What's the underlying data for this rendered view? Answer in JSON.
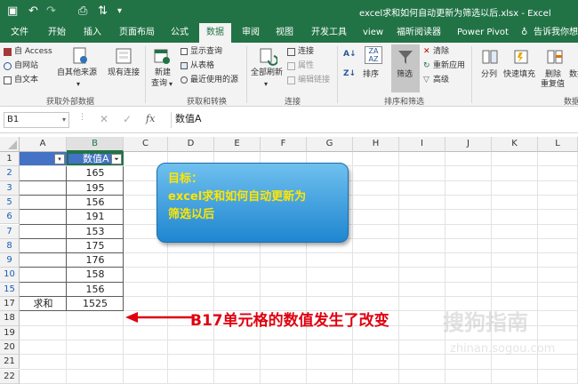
{
  "titlebar": {
    "title": "excel求和如何自动更新为筛选以后.xlsx  -  Excel",
    "icons": [
      "save-icon",
      "undo-icon",
      "redo-icon",
      "print-preview-icon",
      "sort-icon",
      "customize-icon"
    ]
  },
  "tabs": [
    {
      "label": "文件"
    },
    {
      "label": "开始"
    },
    {
      "label": "插入"
    },
    {
      "label": "页面布局"
    },
    {
      "label": "公式"
    },
    {
      "label": "数据",
      "active": true
    },
    {
      "label": "审阅"
    },
    {
      "label": "视图"
    },
    {
      "label": "开发工具"
    },
    {
      "label": "view"
    },
    {
      "label": "福昕阅读器"
    },
    {
      "label": "Power Pivot"
    },
    {
      "label": "告诉我你想要"
    }
  ],
  "ribbon": {
    "access": "自 Access",
    "web": "自网站",
    "text": "自文本",
    "other": "自其他来源",
    "existing": "现有连接",
    "group1": "获取外部数据",
    "newquery1": "新建",
    "newquery2": "查询",
    "showquery": "显示查询",
    "fromtable": "从表格",
    "recent": "最近使用的源",
    "group2": "获取和转换",
    "refresh": "全部刷新",
    "connections": "连接",
    "properties": "属性",
    "editlinks": "编辑链接",
    "group3": "连接",
    "sort": "排序",
    "filter": "筛选",
    "clear": "清除",
    "reapply": "重新应用",
    "advanced": "高级",
    "group4": "排序和筛选",
    "split": "分列",
    "flashfill": "快速填充",
    "dedupe1": "删除",
    "dedupe2": "重复值",
    "validate": "数据",
    "group5": "数据"
  },
  "formula_bar": {
    "name_box": "B1",
    "formula": "数值A"
  },
  "columns": [
    "A",
    "B",
    "C",
    "D",
    "E",
    "F",
    "G",
    "H",
    "I",
    "J",
    "K",
    "L"
  ],
  "selected_column": "B",
  "rows": [
    {
      "num": "1",
      "a": "",
      "b": "数值A",
      "header": true
    },
    {
      "num": "2",
      "a": "",
      "b": "165",
      "filtered": true
    },
    {
      "num": "3",
      "a": "",
      "b": "195",
      "filtered": true
    },
    {
      "num": "5",
      "a": "",
      "b": "156",
      "filtered": true
    },
    {
      "num": "6",
      "a": "",
      "b": "191",
      "filtered": true
    },
    {
      "num": "7",
      "a": "",
      "b": "153",
      "filtered": true
    },
    {
      "num": "8",
      "a": "",
      "b": "175",
      "filtered": true
    },
    {
      "num": "9",
      "a": "",
      "b": "176",
      "filtered": true
    },
    {
      "num": "10",
      "a": "",
      "b": "158",
      "filtered": true
    },
    {
      "num": "15",
      "a": "",
      "b": "156",
      "filtered": true
    },
    {
      "num": "17",
      "a": "求和",
      "b": "1525"
    },
    {
      "num": "18",
      "a": "",
      "b": ""
    },
    {
      "num": "19",
      "a": "",
      "b": ""
    },
    {
      "num": "20",
      "a": "",
      "b": ""
    },
    {
      "num": "21",
      "a": "",
      "b": ""
    },
    {
      "num": "22",
      "a": "",
      "b": ""
    }
  ],
  "callout": {
    "line1": "目标：",
    "line2": "excel求和如何自动更新为",
    "line3": "筛选以后"
  },
  "annotation": "B17单元格的数值发生了改变",
  "watermark": "搜狗指南",
  "watermark_url": "zhinan.sogou.com",
  "colors": {
    "excel_green": "#217346",
    "table_header": "#4472c4",
    "callout_text": "#ffe600",
    "annotation": "#e0000f",
    "filtered_row_number": "#1a5fb4"
  }
}
